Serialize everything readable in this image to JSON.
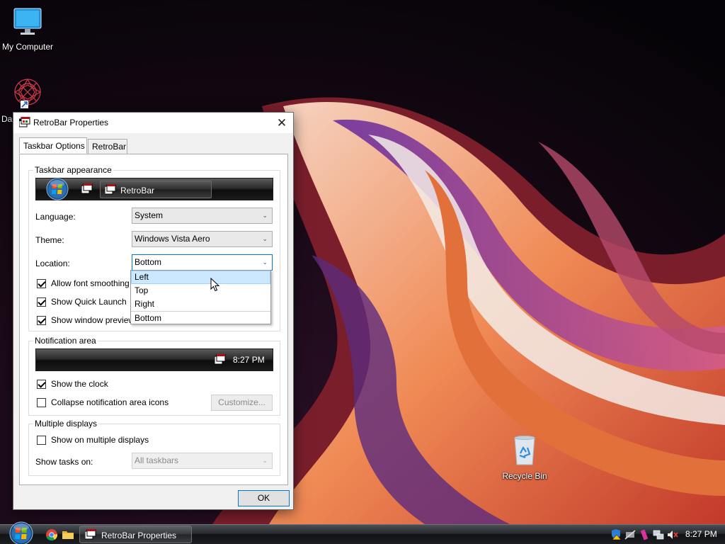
{
  "desktop": {
    "icons": [
      {
        "label": "My Computer"
      },
      {
        "label": "Da"
      },
      {
        "label": "Recycle Bin"
      }
    ]
  },
  "window": {
    "title": "RetroBar Properties",
    "close_glyph": "✕",
    "tabs": [
      {
        "label": "Taskbar Options",
        "active": true
      },
      {
        "label": "RetroBar",
        "active": false
      }
    ],
    "appearance": {
      "title": "Taskbar appearance",
      "preview_task_label": "RetroBar",
      "language_label": "Language:",
      "language_value": "System",
      "theme_label": "Theme:",
      "theme_value": "Windows Vista Aero",
      "location_label": "Location:",
      "location_value": "Bottom",
      "location_options": [
        "Left",
        "Top",
        "Right",
        "Bottom"
      ],
      "hovered_option": "Left",
      "checkboxes": [
        {
          "label": "Allow font smoothing",
          "checked": true
        },
        {
          "label": "Show Quick Launch",
          "checked": true
        },
        {
          "label": "Show window preview",
          "checked": true
        }
      ]
    },
    "notification": {
      "title": "Notification area",
      "preview_clock": "8:27 PM",
      "show_clock_label": "Show the clock",
      "show_clock_checked": true,
      "collapse_label": "Collapse notification area icons",
      "collapse_checked": false,
      "customize_label": "Customize..."
    },
    "multi": {
      "title": "Multiple displays",
      "show_multi_label": "Show on multiple displays",
      "show_multi_checked": false,
      "show_tasks_label": "Show tasks on:",
      "show_tasks_value": "All taskbars"
    },
    "ok_label": "OK"
  },
  "taskbar": {
    "task_label": "RetroBar Properties",
    "clock": "8:27 PM",
    "icons": [
      "start-orb",
      "chrome-icon",
      "folder-icon",
      "retrobar-icon",
      "network-icon",
      "volume-muted-icon"
    ]
  }
}
